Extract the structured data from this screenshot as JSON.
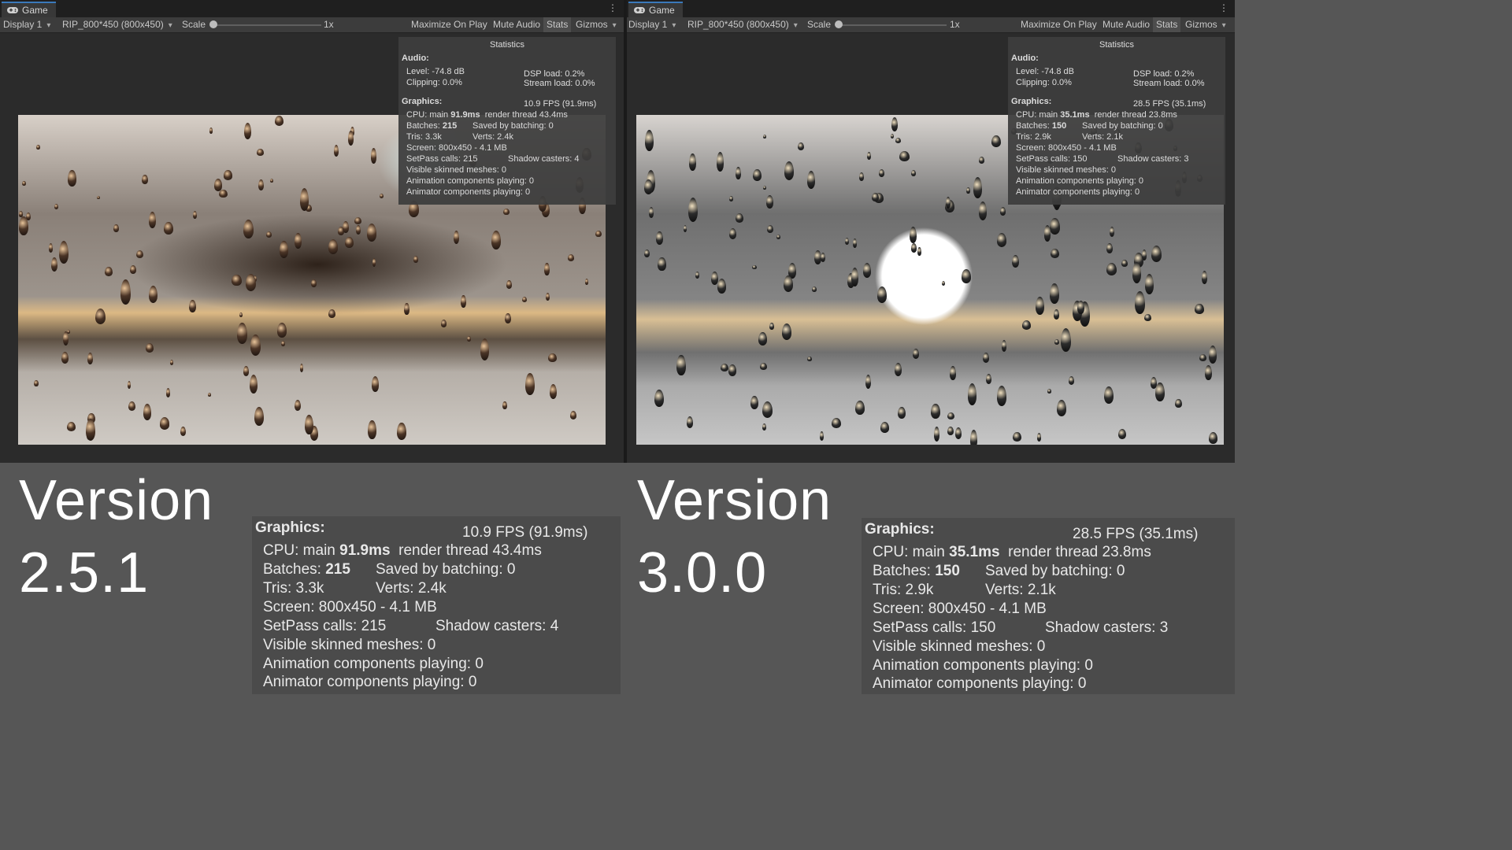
{
  "left": {
    "tab_label": "Game",
    "toolbar": {
      "display": "Display 1",
      "resolution": "RIP_800*450 (800x450)",
      "scale_label": "Scale",
      "scale_value": "1x",
      "maximize": "Maximize On Play",
      "mute": "Mute Audio",
      "stats": "Stats",
      "gizmos": "Gizmos"
    },
    "stats": {
      "title": "Statistics",
      "audio_header": "Audio:",
      "level": "Level: -74.8 dB",
      "clipping": "Clipping: 0.0%",
      "dsp": "DSP load: 0.2%",
      "stream": "Stream load: 0.0%",
      "graphics_header": "Graphics:",
      "fps": "10.9 FPS (91.9ms)",
      "cpu_prefix": "CPU: main ",
      "cpu_main": "91.9ms",
      "render_thread": "render thread 43.4ms",
      "batches_prefix": "Batches: ",
      "batches": "215",
      "saved": "Saved by batching: 0",
      "tris": "Tris: 3.3k",
      "verts": "Verts: 2.4k",
      "screen": "Screen: 800x450 - 4.1 MB",
      "setpass": "SetPass calls: 215",
      "shadow": "Shadow casters: 4",
      "skinned": "Visible skinned meshes: 0",
      "animation": "Animation components playing: 0",
      "animator": "Animator components playing: 0"
    },
    "version_word": "Version",
    "version_number": "2.5.1"
  },
  "right": {
    "tab_label": "Game",
    "toolbar": {
      "display": "Display 1",
      "resolution": "RIP_800*450 (800x450)",
      "scale_label": "Scale",
      "scale_value": "1x",
      "maximize": "Maximize On Play",
      "mute": "Mute Audio",
      "stats": "Stats",
      "gizmos": "Gizmos"
    },
    "stats": {
      "title": "Statistics",
      "audio_header": "Audio:",
      "level": "Level: -74.8 dB",
      "clipping": "Clipping: 0.0%",
      "dsp": "DSP load: 0.2%",
      "stream": "Stream load: 0.0%",
      "graphics_header": "Graphics:",
      "fps": "28.5 FPS (35.1ms)",
      "cpu_prefix": "CPU: main ",
      "cpu_main": "35.1ms",
      "render_thread": "render thread 23.8ms",
      "batches_prefix": "Batches: ",
      "batches": "150",
      "saved": "Saved by batching: 0",
      "tris": "Tris: 2.9k",
      "verts": "Verts: 2.1k",
      "screen": "Screen: 800x450 - 4.1 MB",
      "setpass": "SetPass calls: 150",
      "shadow": "Shadow casters: 3",
      "skinned": "Visible skinned meshes: 0",
      "animation": "Animation components playing: 0",
      "animator": "Animator components playing: 0"
    },
    "version_word": "Version",
    "version_number": "3.0.0"
  },
  "colors": {
    "editor_bg": "#2a2a2a",
    "toolbar_bg": "#3c3c3c",
    "caption_bg": "#565656",
    "tab_accent": "#3a79bb"
  },
  "icons": {
    "tab": "gamepad-icon",
    "menu": "kebab-menu-icon"
  }
}
